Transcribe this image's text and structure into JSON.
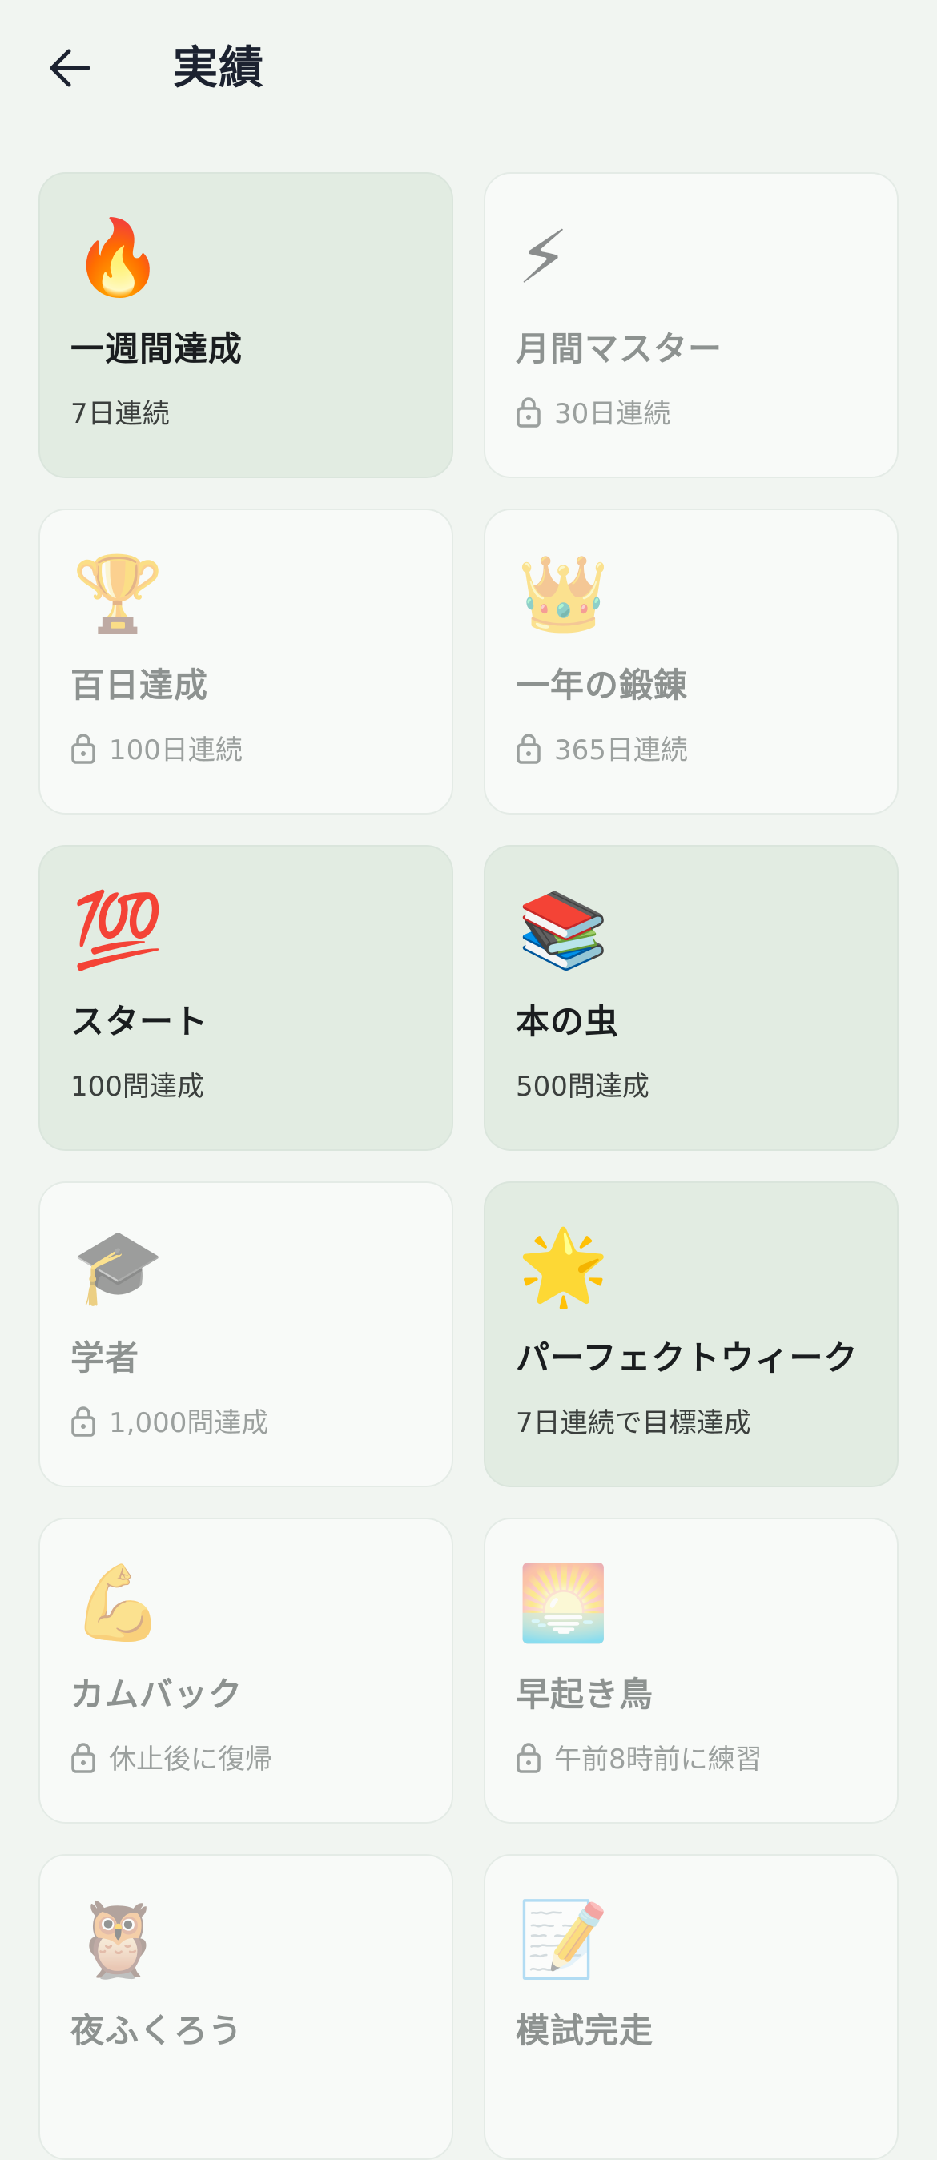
{
  "header": {
    "title": "実績",
    "back_icon": "arrow-left-icon"
  },
  "achievements": [
    {
      "emoji": "🔥",
      "icon": "fire-icon",
      "title": "一週間達成",
      "desc": "7日連続",
      "locked": false
    },
    {
      "emoji": "⚡",
      "icon": "lightning-icon",
      "title": "月間マスター",
      "desc": "30日連続",
      "locked": true
    },
    {
      "emoji": "🏆",
      "icon": "trophy-icon",
      "title": "百日達成",
      "desc": "100日連続",
      "locked": true
    },
    {
      "emoji": "👑",
      "icon": "crown-icon",
      "title": "一年の鍛錬",
      "desc": "365日連続",
      "locked": true
    },
    {
      "emoji": "💯",
      "icon": "hundred-points-icon",
      "title": "スタート",
      "desc": "100問達成",
      "locked": false
    },
    {
      "emoji": "📚",
      "icon": "books-icon",
      "title": "本の虫",
      "desc": "500問達成",
      "locked": false
    },
    {
      "emoji": "🎓",
      "icon": "graduation-cap-icon",
      "title": "学者",
      "desc": "1,000問達成",
      "locked": true
    },
    {
      "emoji": "🌟",
      "icon": "glowing-star-icon",
      "title": "パーフェクトウィーク",
      "desc": "7日連続で目標達成",
      "locked": false
    },
    {
      "emoji": "💪",
      "icon": "flexed-biceps-icon",
      "title": "カムバック",
      "desc": "休止後に復帰",
      "locked": true
    },
    {
      "emoji": "🌅",
      "icon": "sunrise-icon",
      "title": "早起き鳥",
      "desc": "午前8時前に練習",
      "locked": true
    },
    {
      "emoji": "🦉",
      "icon": "owl-icon",
      "title": "夜ふくろう",
      "desc": "",
      "locked": true
    },
    {
      "emoji": "📝",
      "icon": "memo-icon",
      "title": "模試完走",
      "desc": "",
      "locked": true
    }
  ],
  "colors": {
    "background": "#f1f5f1",
    "card_unlocked": "#e2ece2",
    "card_locked": "#f8faf8",
    "text_dark": "#1a1d1f",
    "text_muted": "#9ba09e"
  }
}
